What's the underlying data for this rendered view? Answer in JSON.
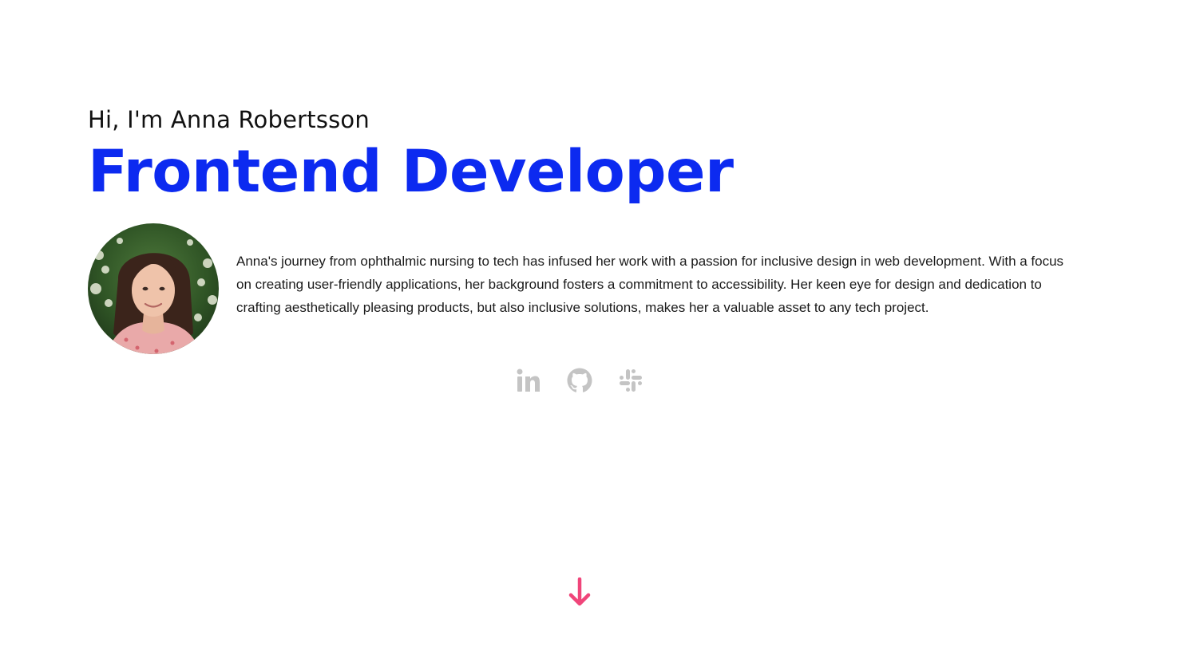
{
  "hero": {
    "greeting": "Hi, I'm Anna Robertsson",
    "role": "Frontend Developer",
    "bio": "Anna's journey from ophthalmic nursing to tech has infused her work with a passion for inclusive design in web development. With a focus on creating user-friendly applications, her background fosters a commitment to accessibility. Her keen eye for design and dedication to crafting aesthetically pleasing products, but also inclusive solutions, makes her a valuable asset to any tech project."
  },
  "socials": [
    {
      "icon": "linkedin-icon"
    },
    {
      "icon": "github-icon"
    },
    {
      "icon": "slack-icon"
    }
  ],
  "colors": {
    "accent": "#0c2af0",
    "icon_gray": "#c4c4c4",
    "arrow": "#f0457a",
    "text": "#111111"
  },
  "scroll": {
    "icon": "arrow-down-icon"
  }
}
